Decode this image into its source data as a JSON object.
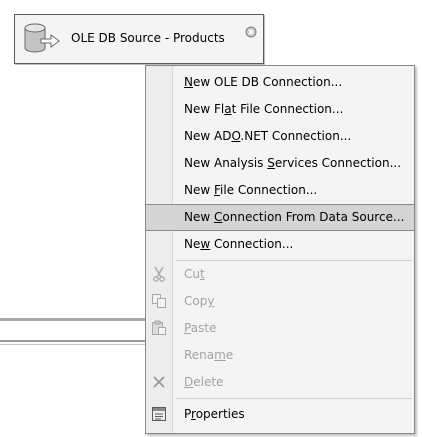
{
  "task": {
    "label": "OLE DB Source - Products"
  },
  "menu": {
    "items": [
      {
        "pre": "",
        "u": "N",
        "post": "ew OLE DB Connection..."
      },
      {
        "pre": "New Fl",
        "u": "a",
        "post": "t File Connection..."
      },
      {
        "pre": "New AD",
        "u": "O",
        "post": ".NET Connection..."
      },
      {
        "pre": "New Analysis ",
        "u": "S",
        "post": "ervices Connection..."
      },
      {
        "pre": "New ",
        "u": "F",
        "post": "ile Connection..."
      },
      {
        "pre": "New ",
        "u": "C",
        "post": "onnection From Data Source..."
      },
      {
        "pre": "Ne",
        "u": "w",
        "post": " Connection..."
      },
      {
        "pre": "Cu",
        "u": "t",
        "post": ""
      },
      {
        "pre": "Cop",
        "u": "y",
        "post": ""
      },
      {
        "pre": "",
        "u": "P",
        "post": "aste"
      },
      {
        "pre": "Rena",
        "u": "m",
        "post": "e"
      },
      {
        "pre": "",
        "u": "D",
        "post": "elete"
      },
      {
        "pre": "P",
        "u": "r",
        "post": "operties"
      }
    ]
  }
}
